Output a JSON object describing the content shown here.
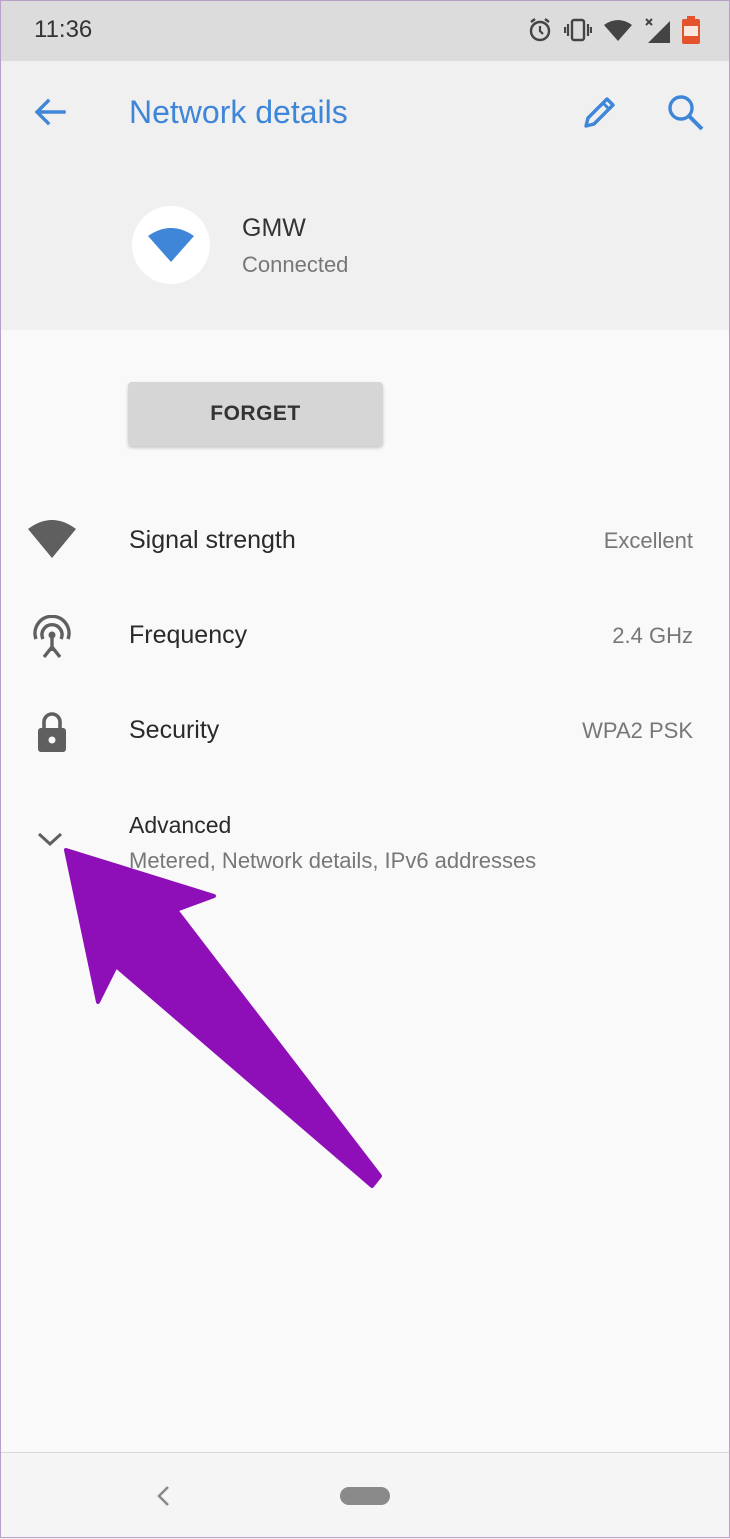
{
  "status_bar": {
    "time": "11:36",
    "icons": [
      "alarm-icon",
      "vibrate-icon",
      "wifi-icon",
      "cell-signal-icon",
      "battery-icon"
    ],
    "battery_level": "42",
    "battery_color": "#e5532d"
  },
  "header": {
    "title": "Network details",
    "accent_color": "#3f86d8"
  },
  "network": {
    "name": "GMW",
    "status": "Connected"
  },
  "actions": {
    "forget_label": "FORGET"
  },
  "details": [
    {
      "icon": "wifi-signal-icon",
      "label": "Signal strength",
      "value": "Excellent"
    },
    {
      "icon": "antenna-icon",
      "label": "Frequency",
      "value": "2.4 GHz"
    },
    {
      "icon": "lock-icon",
      "label": "Security",
      "value": "WPA2 PSK"
    }
  ],
  "advanced": {
    "label": "Advanced",
    "summary": "Metered, Network details, IPv6 addresses"
  },
  "annotation": {
    "arrow_color": "#8e0fb8"
  }
}
